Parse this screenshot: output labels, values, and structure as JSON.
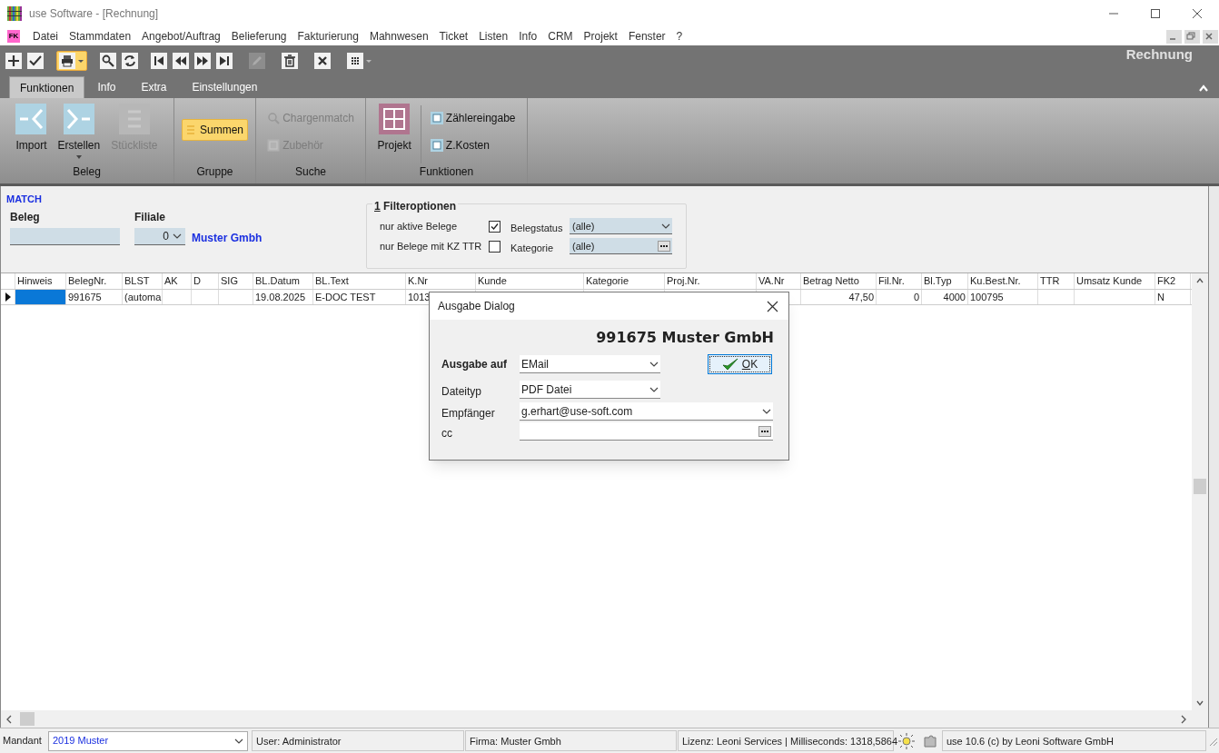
{
  "window": {
    "title": "use Software - [Rechnung]"
  },
  "menu": {
    "logo": "FK",
    "items": [
      "Datei",
      "Stammdaten",
      "Angebot/Auftrag",
      "Belieferung",
      "Fakturierung",
      "Mahnwesen",
      "Ticket",
      "Listen",
      "Info",
      "CRM",
      "Projekt",
      "Fenster",
      "?"
    ]
  },
  "toolbar": {
    "title": "Rechnung",
    "buttons": [
      {
        "kind": "add",
        "disabled": false,
        "highlighted": false
      },
      {
        "kind": "confirm",
        "disabled": false,
        "highlighted": false
      },
      {
        "kind": "print",
        "disabled": false,
        "highlighted": true
      },
      {
        "kind": "search",
        "disabled": false,
        "highlighted": false
      },
      {
        "kind": "refresh",
        "disabled": false,
        "highlighted": false
      },
      {
        "kind": "first",
        "disabled": false,
        "highlighted": false
      },
      {
        "kind": "previous",
        "disabled": false,
        "highlighted": false
      },
      {
        "kind": "next",
        "disabled": false,
        "highlighted": false
      },
      {
        "kind": "last",
        "disabled": false,
        "highlighted": false
      },
      {
        "kind": "edit",
        "disabled": true,
        "highlighted": false
      },
      {
        "kind": "delete",
        "disabled": false,
        "highlighted": false
      },
      {
        "kind": "cancel",
        "disabled": false,
        "highlighted": false
      },
      {
        "kind": "grid",
        "disabled": false,
        "highlighted": false
      }
    ]
  },
  "tabs": [
    {
      "label": "Funktionen",
      "selected": true
    },
    {
      "label": "Info",
      "selected": false
    },
    {
      "label": "Extra",
      "selected": false
    },
    {
      "label": "Einstellungen",
      "selected": false
    }
  ],
  "ribbon": [
    {
      "label": "Beleg",
      "items": [
        {
          "kind": "large",
          "label": "Import",
          "disabled": false,
          "highlighted": false,
          "dropdown": false
        },
        {
          "kind": "large",
          "label": "Erstellen",
          "disabled": false,
          "highlighted": false,
          "dropdown": true
        },
        {
          "kind": "large",
          "label": "Stückliste",
          "disabled": true,
          "highlighted": false,
          "dropdown": false
        }
      ]
    },
    {
      "label": "Gruppe",
      "items": [
        {
          "kind": "small",
          "label": "Summen",
          "disabled": false,
          "highlighted": true,
          "dropdown": false
        }
      ]
    },
    {
      "label": "Suche",
      "items": [
        {
          "kind": "small",
          "label": "Chargenmatch",
          "disabled": true,
          "highlighted": false,
          "dropdown": false
        },
        {
          "kind": "small",
          "label": "Zubehör",
          "disabled": true,
          "highlighted": false,
          "dropdown": false
        }
      ]
    },
    {
      "label": "Funktionen",
      "items": [
        {
          "kind": "large",
          "label": "Projekt",
          "disabled": false,
          "highlighted": false,
          "dropdown": false
        },
        {
          "kind": "small",
          "label": "Zählereingabe",
          "disabled": false,
          "highlighted": false,
          "dropdown": false
        },
        {
          "kind": "small",
          "label": "Z.Kosten",
          "disabled": false,
          "highlighted": false,
          "dropdown": false
        }
      ]
    }
  ],
  "filter": {
    "heading": "MATCH",
    "beleg": {
      "label": "Beleg"
    },
    "filiale": {
      "label": "Filiale",
      "value": "0",
      "name": "Muster Gmbh"
    },
    "options": {
      "title_key": "1",
      "title": "Filteroptionen",
      "checks": [
        {
          "label": "nur aktive Belege",
          "checked": true
        },
        {
          "label": "nur Belege mit KZ TTR",
          "checked": false
        }
      ],
      "selects": [
        {
          "label": "Belegstatus",
          "value": "(alle)",
          "kind": "dropdown"
        },
        {
          "label": "Kategorie",
          "value": "(alle)",
          "kind": "picker"
        }
      ]
    }
  },
  "table": {
    "columns": [
      "Hinweis",
      "BelegNr.",
      "BLST",
      "AK",
      "D",
      "SIG",
      "BL.Datum",
      "BL.Text",
      "K.Nr",
      "Kunde",
      "Kategorie",
      "Proj.Nr.",
      "VA.Nr",
      "Betrag Netto",
      "Fil.Nr.",
      "Bl.Typ",
      "Ku.Best.Nr.",
      "TTR",
      "Umsatz Kunde",
      "FK2"
    ],
    "rows": [
      {
        "selected": true,
        "cells": [
          null,
          "991675",
          "(automa",
          null,
          null,
          null,
          "19.08.2025",
          "E-DOC TEST",
          "1013",
          null,
          null,
          null,
          null,
          "47,50",
          "0",
          "4000",
          "100795",
          null,
          null,
          "N"
        ]
      }
    ]
  },
  "dialog": {
    "title": "Ausgabe Dialog",
    "heading": "991675 Muster GmbH",
    "ok": {
      "key": "O",
      "rest": "K"
    },
    "fields": [
      {
        "label": "Ausgabe auf",
        "value": "EMail",
        "kind": "dropdown",
        "emphasis": true
      },
      {
        "label": "Dateityp",
        "value": "PDF Datei",
        "kind": "dropdown",
        "emphasis": false
      },
      {
        "label": "Empfänger",
        "value": "g.erhart@use-soft.com",
        "kind": "wide-dropdown",
        "emphasis": false
      },
      {
        "label": "cc",
        "kind": "picker",
        "emphasis": false
      }
    ]
  },
  "status_bar": {
    "mandant_label": "Mandant",
    "mandant": "2019 Muster",
    "user": "User: Administrator",
    "firma": "Firma: Muster Gmbh",
    "lizenz": "Lizenz: Leoni Services | Milliseconds: 1318,5864",
    "version": "use 10.6 (c) by Leoni Software GmbH"
  }
}
